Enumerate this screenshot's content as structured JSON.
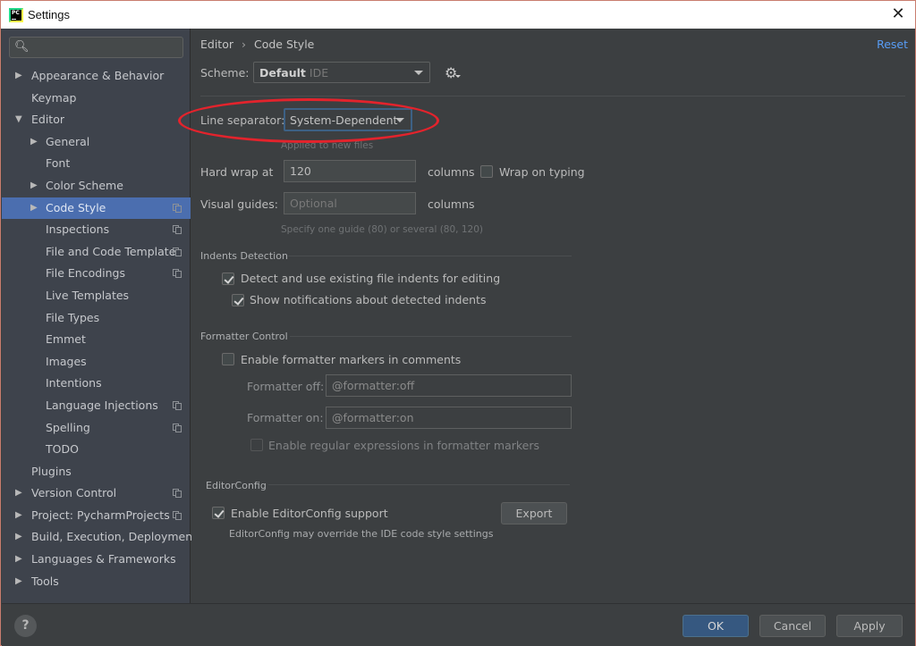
{
  "window": {
    "title": "Settings",
    "close_icon": "close-icon"
  },
  "sidebar": {
    "search": {
      "placeholder": "",
      "value": ""
    },
    "items": [
      {
        "label": "Appearance & Behavior",
        "level": 0,
        "expandable": true,
        "expanded": false,
        "project_icon": false
      },
      {
        "label": "Keymap",
        "level": 0,
        "expandable": false,
        "project_icon": false
      },
      {
        "label": "Editor",
        "level": 0,
        "expandable": true,
        "expanded": true,
        "project_icon": false
      },
      {
        "label": "General",
        "level": 1,
        "expandable": true,
        "expanded": false,
        "project_icon": false
      },
      {
        "label": "Font",
        "level": 1,
        "expandable": false,
        "project_icon": false
      },
      {
        "label": "Color Scheme",
        "level": 1,
        "expandable": true,
        "expanded": false,
        "project_icon": false
      },
      {
        "label": "Code Style",
        "level": 1,
        "expandable": true,
        "expanded": false,
        "project_icon": true,
        "selected": true
      },
      {
        "label": "Inspections",
        "level": 1,
        "expandable": false,
        "project_icon": true
      },
      {
        "label": "File and Code Templates",
        "level": 1,
        "expandable": false,
        "project_icon": true
      },
      {
        "label": "File Encodings",
        "level": 1,
        "expandable": false,
        "project_icon": true
      },
      {
        "label": "Live Templates",
        "level": 1,
        "expandable": false,
        "project_icon": false
      },
      {
        "label": "File Types",
        "level": 1,
        "expandable": false,
        "project_icon": false
      },
      {
        "label": "Emmet",
        "level": 1,
        "expandable": false,
        "project_icon": false
      },
      {
        "label": "Images",
        "level": 1,
        "expandable": false,
        "project_icon": false
      },
      {
        "label": "Intentions",
        "level": 1,
        "expandable": false,
        "project_icon": false
      },
      {
        "label": "Language Injections",
        "level": 1,
        "expandable": false,
        "project_icon": true
      },
      {
        "label": "Spelling",
        "level": 1,
        "expandable": false,
        "project_icon": true
      },
      {
        "label": "TODO",
        "level": 1,
        "expandable": false,
        "project_icon": false
      },
      {
        "label": "Plugins",
        "level": 0,
        "expandable": false,
        "project_icon": false
      },
      {
        "label": "Version Control",
        "level": 0,
        "expandable": true,
        "expanded": false,
        "project_icon": true
      },
      {
        "label": "Project: PycharmProjects",
        "level": 0,
        "expandable": true,
        "expanded": false,
        "project_icon": true
      },
      {
        "label": "Build, Execution, Deployment",
        "level": 0,
        "expandable": true,
        "expanded": false,
        "project_icon": false
      },
      {
        "label": "Languages & Frameworks",
        "level": 0,
        "expandable": true,
        "expanded": false,
        "project_icon": false
      },
      {
        "label": "Tools",
        "level": 0,
        "expandable": true,
        "expanded": false,
        "project_icon": false
      }
    ]
  },
  "main": {
    "breadcrumb": [
      "Editor",
      "Code Style"
    ],
    "breadcrumb_separator": "›",
    "reset_label": "Reset",
    "scheme": {
      "label": "Scheme:",
      "value": "Default",
      "qualifier": "IDE"
    },
    "line_separator": {
      "label": "Line separator:",
      "value": "System-Dependent",
      "hint": "Applied to new files"
    },
    "hard_wrap": {
      "label": "Hard wrap at",
      "value": "120",
      "units": "columns"
    },
    "wrap_on_typing": {
      "label": "Wrap on typing",
      "checked": false
    },
    "visual_guides": {
      "label": "Visual guides:",
      "placeholder": "Optional",
      "value": "",
      "units": "columns",
      "hint": "Specify one guide (80) or several (80, 120)"
    },
    "indents_detection": {
      "title": "Indents Detection",
      "detect": {
        "label": "Detect and use existing file indents for editing",
        "checked": true
      },
      "notify": {
        "label": "Show notifications about detected indents",
        "checked": true
      }
    },
    "formatter_control": {
      "title": "Formatter Control",
      "enable_markers": {
        "label": "Enable formatter markers in comments",
        "checked": false
      },
      "off": {
        "label": "Formatter off:",
        "value": "@formatter:off"
      },
      "on": {
        "label": "Formatter on:",
        "value": "@formatter:on"
      },
      "regex": {
        "label": "Enable regular expressions in formatter markers",
        "checked": false,
        "disabled": true
      }
    },
    "editorconfig": {
      "title": "EditorConfig",
      "enable": {
        "label": "Enable EditorConfig support",
        "checked": true
      },
      "note": "EditorConfig may override the IDE code style settings",
      "export_label": "Export"
    }
  },
  "footer": {
    "help_label": "?",
    "ok_label": "OK",
    "cancel_label": "Cancel",
    "apply_label": "Apply"
  },
  "annotation": {
    "type": "red-ellipse",
    "target": "line-separator",
    "color": "#e3232c"
  },
  "colors": {
    "accent": "#4b6eaf",
    "link": "#589df6",
    "primary_button": "#365880",
    "background": "#3c3f41",
    "sidebar": "#3e434c"
  }
}
